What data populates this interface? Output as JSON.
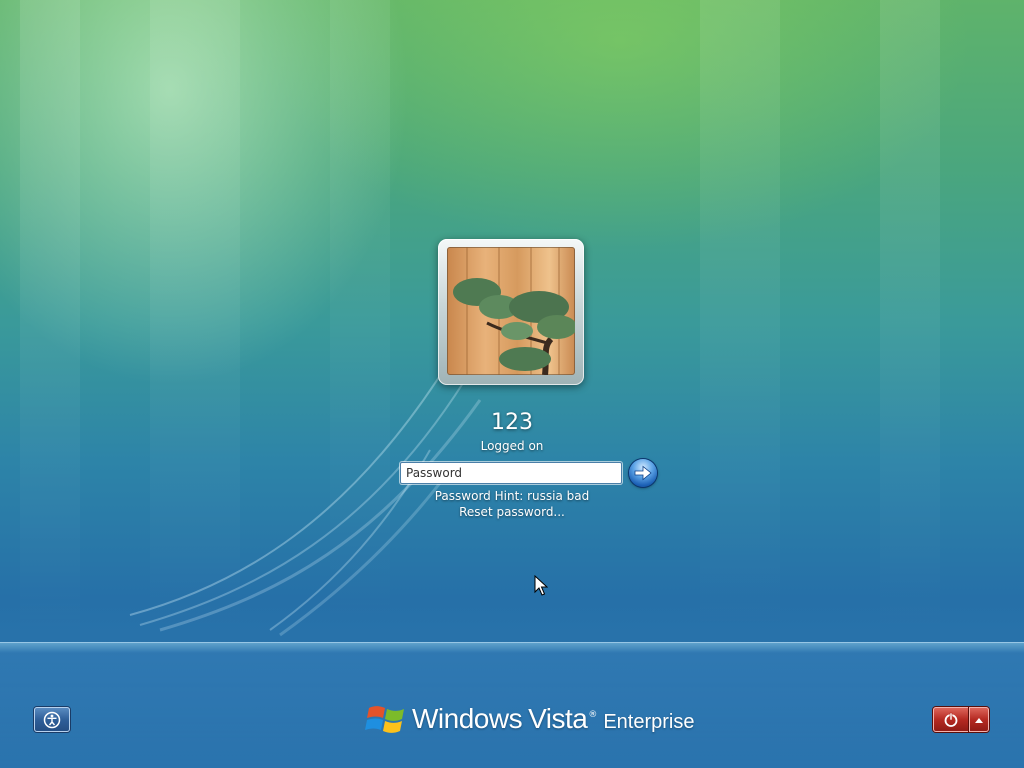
{
  "user": {
    "name": "123",
    "status": "Logged on"
  },
  "password": {
    "placeholder": "Password",
    "value": "",
    "hint": "Password Hint: russia bad",
    "reset_link": "Reset password..."
  },
  "branding": {
    "windows": "Windows",
    "vista": "Vista",
    "trademark": "®",
    "edition": "Enterprise"
  },
  "icons": {
    "submit": "arrow-right-icon",
    "ease_of_access": "ease-of-access-icon",
    "power": "power-icon",
    "power_options": "triangle-up-icon",
    "logo": "windows-flag-icon"
  },
  "colors": {
    "submit_button": "#1b5fb5",
    "power_button": "#b52a22",
    "ease_button": "#2f5f99"
  }
}
